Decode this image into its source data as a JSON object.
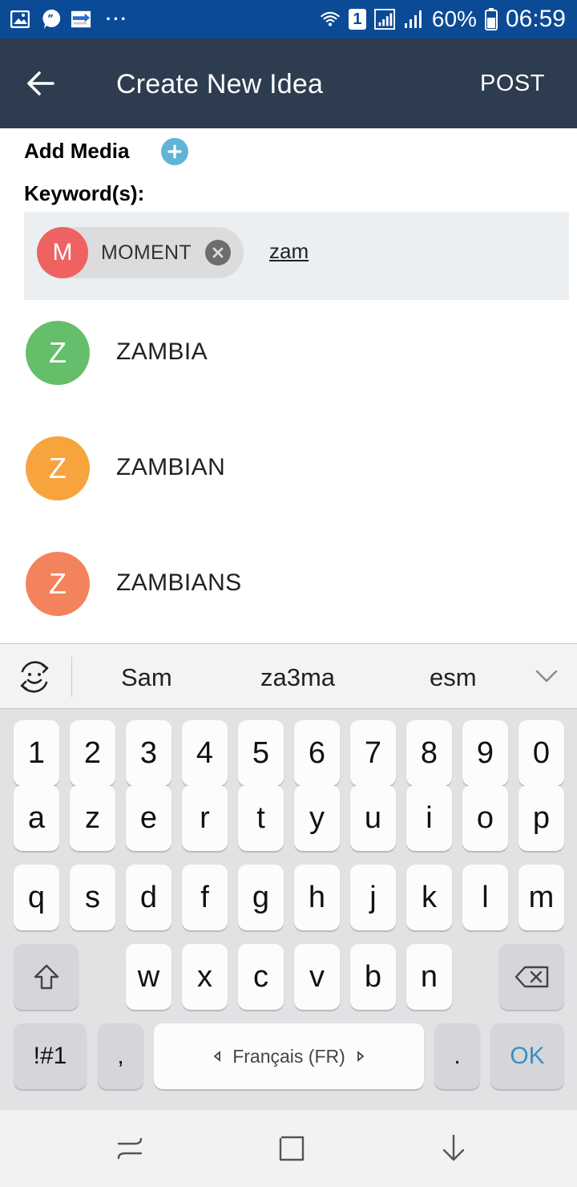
{
  "status_bar": {
    "battery_percent": "60%",
    "time": "06:59",
    "sim_badge": "1",
    "color": "#0b4a95"
  },
  "app_bar": {
    "title": "Create New Idea",
    "post_label": "POST",
    "color": "#2d3c4e"
  },
  "form": {
    "add_media_label": "Add Media",
    "keywords_label": "Keyword(s):",
    "chips": [
      {
        "initial": "M",
        "label": "MOMENT",
        "color": "#ef6262"
      }
    ],
    "input_value": "zam"
  },
  "suggestions": [
    {
      "initial": "Z",
      "label": "ZAMBIA",
      "color": "#65bf6a"
    },
    {
      "initial": "Z",
      "label": "ZAMBIAN",
      "color": "#f7a43e"
    },
    {
      "initial": "Z",
      "label": "ZAMBIANS",
      "color": "#f2835c"
    }
  ],
  "keyboard": {
    "word_suggestions": [
      "Sam",
      "za3ma",
      "esm"
    ],
    "row_digits": [
      "1",
      "2",
      "3",
      "4",
      "5",
      "6",
      "7",
      "8",
      "9",
      "0"
    ],
    "row1": [
      "a",
      "z",
      "e",
      "r",
      "t",
      "y",
      "u",
      "i",
      "o",
      "p"
    ],
    "row2": [
      "q",
      "s",
      "d",
      "f",
      "g",
      "h",
      "j",
      "k",
      "l",
      "m"
    ],
    "row3": [
      "w",
      "x",
      "c",
      "v",
      "b",
      "n"
    ],
    "symbols_label": "!#1",
    "comma_label": ",",
    "space_label": "Français (FR)",
    "period_label": ".",
    "ok_label": "OK"
  }
}
